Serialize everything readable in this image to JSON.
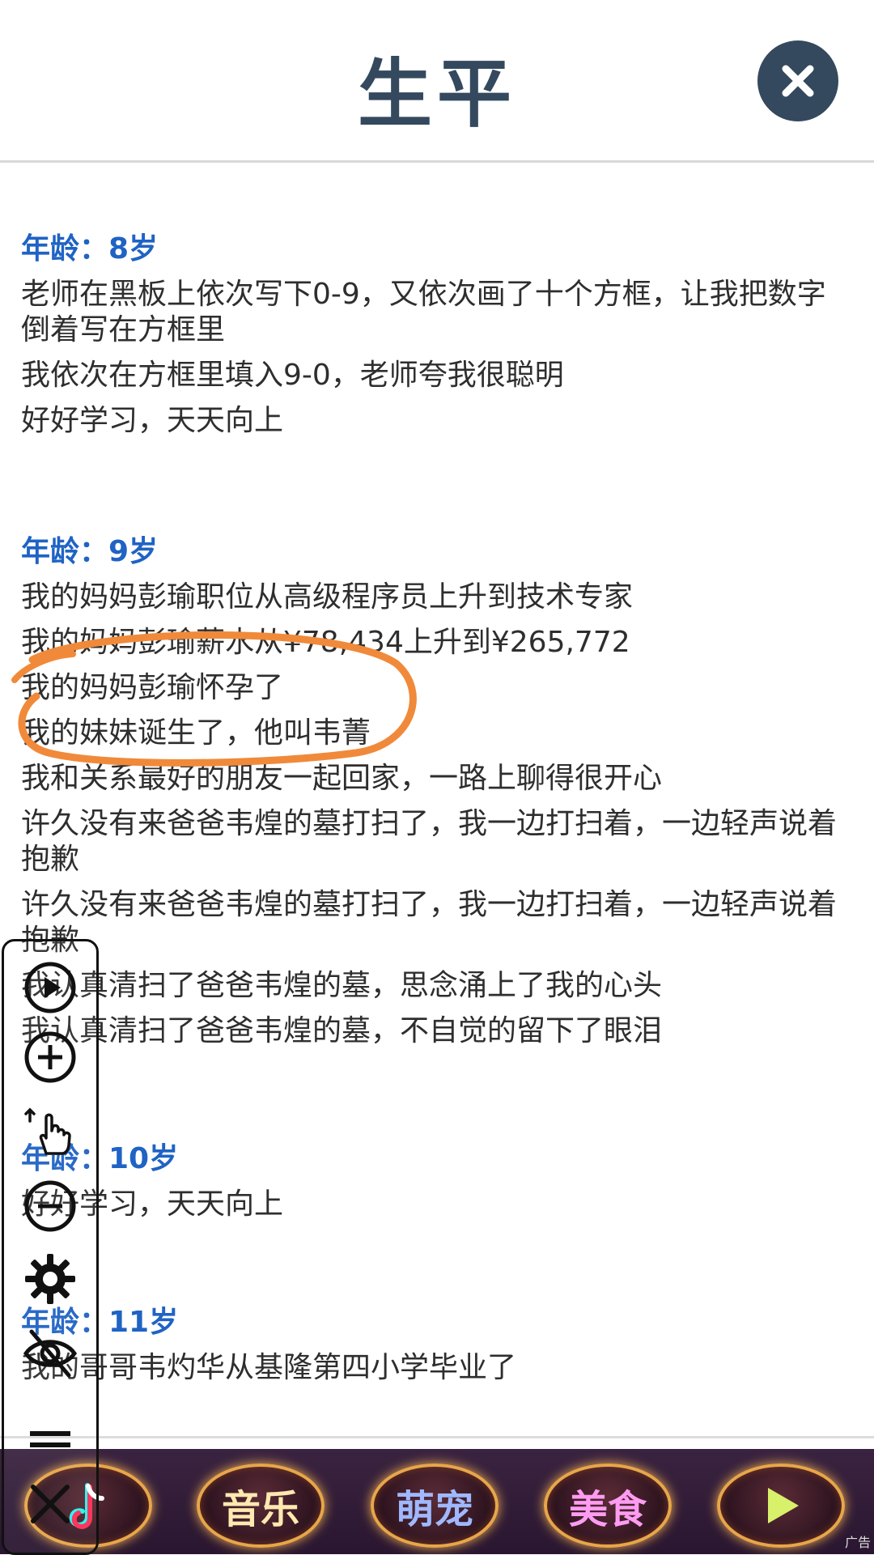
{
  "header": {
    "title": "生平"
  },
  "sections": [
    {
      "age": "年龄：8岁",
      "lines": [
        "老师在黑板上依次写下0-9，又依次画了十个方框，让我把数字倒着写在方框里",
        "我依次在方框里填入9-0，老师夸我很聪明",
        "好好学习，天天向上"
      ]
    },
    {
      "age": "年龄：9岁",
      "lines": [
        "我的妈妈彭瑜职位从高级程序员上升到技术专家",
        "我的妈妈彭瑜薪水从¥78,434上升到¥265,772",
        "我的妈妈彭瑜怀孕了",
        "我的妹妹诞生了，他叫韦菁",
        "我和关系最好的朋友一起回家，一路上聊得很开心",
        "许久没有来爸爸韦煌的墓打扫了，我一边打扫着，一边轻声说着抱歉",
        "许久没有来爸爸韦煌的墓打扫了，我一边打扫着，一边轻声说着抱歉",
        "我认真清扫了爸爸韦煌的墓，思念涌上了我的心头",
        "我认真清扫了爸爸韦煌的墓，不自觉的留下了眼泪"
      ]
    },
    {
      "age": "年龄：10岁",
      "lines": [
        "好好学习，天天向上"
      ]
    },
    {
      "age": "年龄：11岁",
      "lines": [
        "我的哥哥韦灼华从基隆第四小学毕业了"
      ]
    }
  ],
  "ad_banner": {
    "buttons": [
      "",
      "音乐",
      "萌宠",
      "美食",
      ""
    ],
    "tag": "广告"
  },
  "toolbar": {
    "icons": [
      "play-icon",
      "zoom-in-icon",
      "hand-pointer-icon",
      "zoom-out-icon",
      "gear-icon",
      "eye-off-icon",
      "menu-icon",
      "close-icon"
    ]
  },
  "colors": {
    "title": "#34495e",
    "age_label": "#1f63c4",
    "annotation": "#f08a3a"
  }
}
